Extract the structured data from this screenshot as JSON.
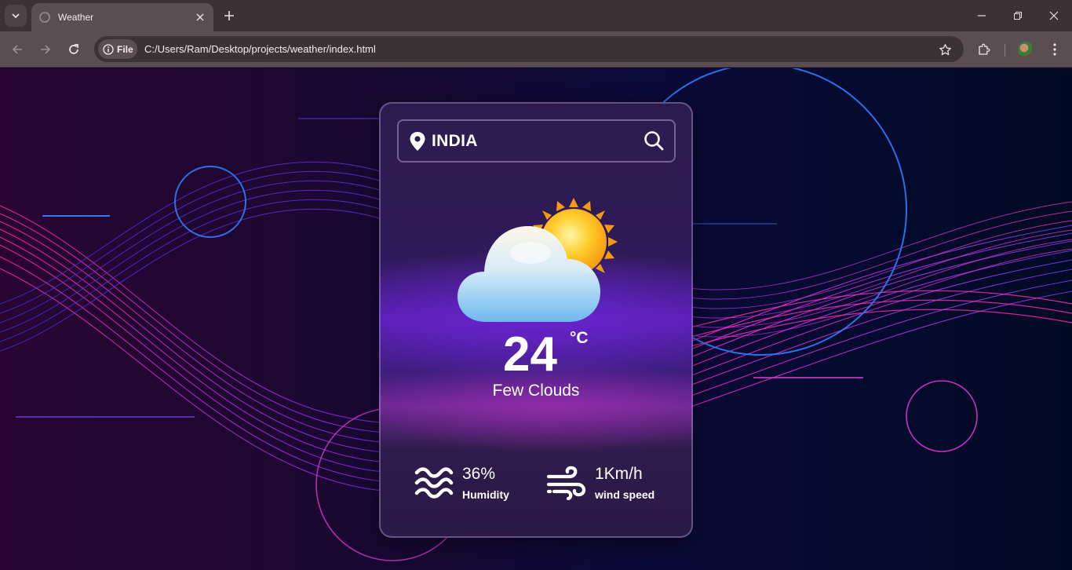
{
  "browser": {
    "tab_title": "Weather",
    "url_scheme_label": "File",
    "url": "C:/Users/Ram/Desktop/projects/weather/index.html"
  },
  "weather": {
    "location": "INDIA",
    "temperature": "24",
    "unit": "°C",
    "description": "Few Clouds",
    "humidity": {
      "value": "36%",
      "label": "Humidity"
    },
    "wind": {
      "value": "1Km/h",
      "label": "wind speed"
    },
    "icon": "cloud-sun"
  },
  "icons": {
    "location": "location-pin-icon",
    "search": "search-icon",
    "humidity": "waves-icon",
    "wind": "wind-icon"
  },
  "colors": {
    "chrome_bar": "#3c3236",
    "toolbar": "#5a4e52",
    "accent_purple": "#5a1fb6",
    "accent_magenta": "#e030c8"
  }
}
